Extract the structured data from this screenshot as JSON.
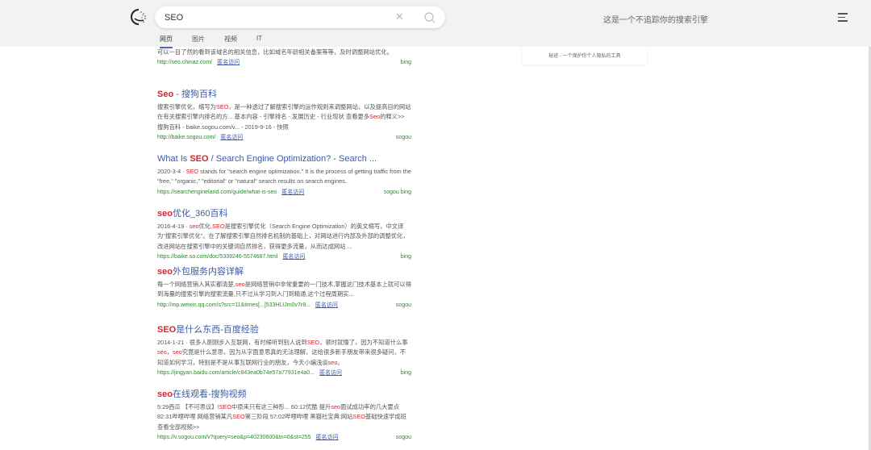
{
  "search": {
    "query": "SEO"
  },
  "tabs": [
    {
      "label": "网页",
      "active": true
    },
    {
      "label": "图片"
    },
    {
      "label": "视频"
    },
    {
      "label": "IT"
    }
  ],
  "slogan": "这是一个不追踪你的搜索引擎",
  "sidecard": {
    "text": "秘迹 - 一个保护你个人隐私的工具"
  },
  "anon_label": "匿名访问",
  "results": [
    {
      "title": [],
      "snippet": [
        {
          "t": "可以一目了然的看到该域名的相关信息，比如域名年龄相关备案等等，及时调整网站优化。"
        }
      ],
      "url": "http://seo.chinaz.com/",
      "source": "bing"
    },
    {
      "title": [
        {
          "t": "Seo",
          "hl": true
        },
        {
          "t": " - 搜狗百科"
        }
      ],
      "snippet": [
        {
          "t": "搜索引擎优化，缩写为"
        },
        {
          "t": "SEO",
          "hl": true
        },
        {
          "t": "，是一种透过了解搜索引擎的运作规则来调整网站，以及提高目的网站在有关搜索引擎内排名的方... 基本内容 - 引擎排名 - 发展历史 - 行业现状 查看更多"
        },
        {
          "t": "Seo",
          "hl": true
        },
        {
          "t": "的释义>> 搜狗百科 - baike.sogou.com/v... - 2019-9-16 - 快照"
        }
      ],
      "url": "http://baike.sogou.com/",
      "source": "sogou"
    },
    {
      "title": [
        {
          "t": "What Is "
        },
        {
          "t": "SEO",
          "hl": true
        },
        {
          "t": " / Search Engine Optimization? - Search ..."
        }
      ],
      "snippet": [
        {
          "t": "2020-3-4 · "
        },
        {
          "t": "SEO",
          "hl": true
        },
        {
          "t": " stands for \"search engine optimization.\" It is the process of getting traffic from the \"free,\" \"organic,\" \"editorial\" or \"natural\" search results on search engines."
        }
      ],
      "url": "https://searchengineland.com/guide/what-is-seo",
      "source": "sogou bing"
    },
    {
      "title": [
        {
          "t": "seo",
          "hl": true
        },
        {
          "t": "优化_360百科"
        }
      ],
      "snippet": [
        {
          "t": "2016-4-19 · "
        },
        {
          "t": "seo",
          "hl": true
        },
        {
          "t": "优化,"
        },
        {
          "t": "SEO",
          "hl": true
        },
        {
          "t": "是搜索引擎优化（Search Engine Optimization）的英文缩写，中文译为\"搜索引擎优化\"。在了解搜索引擎自然排名机制的基础上，对网站进行内部及外部的调整优化，改进网站在搜索引擎中的关键词自然排名，获得更多流量，从而达成网站 ..."
        }
      ],
      "url": "https://baike.so.com/doc/5339246-5574687.html",
      "source": "bing"
    },
    {
      "title": [
        {
          "t": "seo",
          "hl": true
        },
        {
          "t": "外包服务内容详解"
        }
      ],
      "snippet": [
        {
          "t": "每一个网络营销人其实都清楚,"
        },
        {
          "t": "seo",
          "hl": true
        },
        {
          "t": "是网络营销中非常重要的一门技术,掌握这门技术基本上就可以得到海量的搜索引擎的搜索流量,只不过从学习到入门到精通,这个过程周期实..."
        }
      ],
      "url": "http://mp.weixin.qq.com/s?src=11&times[...]533HLIJm0v7r8...",
      "source": "sogou"
    },
    {
      "title": [
        {
          "t": "SEO",
          "hl": true
        },
        {
          "t": "是什么东西-百度经验"
        }
      ],
      "snippet": [
        {
          "t": "2014-1-21 · 很多人刚刚步入互联网，有时候听到别人说到"
        },
        {
          "t": "SEO",
          "hl": true
        },
        {
          "t": "，顿时就懵了，因为不知道什么事"
        },
        {
          "t": "seo",
          "hl": true
        },
        {
          "t": "，"
        },
        {
          "t": "seo",
          "hl": true
        },
        {
          "t": "究竟是什么意思，因为从字面意思真的无法理解，这给很多新手朋友带来很多疑问，不知道如何学习，特别是不是从事互联网行业的朋友，今天小编浅谈"
        },
        {
          "t": "seo",
          "hl": true
        },
        {
          "t": "。"
        }
      ],
      "url": "https://jingyan.baidu.com/article/c843ea0b74e57a77931e4a0...",
      "source": "bing"
    },
    {
      "title": [
        {
          "t": "seo",
          "hl": true
        },
        {
          "t": "在线观看-搜狗视频"
        }
      ],
      "snippet": [
        {
          "t": "5:29西瓜 【不可思议】!"
        },
        {
          "t": "SEO",
          "hl": true
        },
        {
          "t": "中原来只有这三种形... 60:12优酷 提升"
        },
        {
          "t": "seo",
          "hl": true
        },
        {
          "t": "面试成功率的几大要点 82:31哔哩哔哩 网络营销某凡"
        },
        {
          "t": "SEO",
          "hl": true
        },
        {
          "t": "第三阶段 57:02哔哩哔哩 黑猫社宝典:网站"
        },
        {
          "t": "SEO",
          "hl": true
        },
        {
          "t": "基础快速学成班 查看全部视频>>"
        }
      ],
      "url": "https://v.sogou.com/v?query=seo&p=40230600&tn=0&st=255",
      "source": "sogou"
    }
  ]
}
